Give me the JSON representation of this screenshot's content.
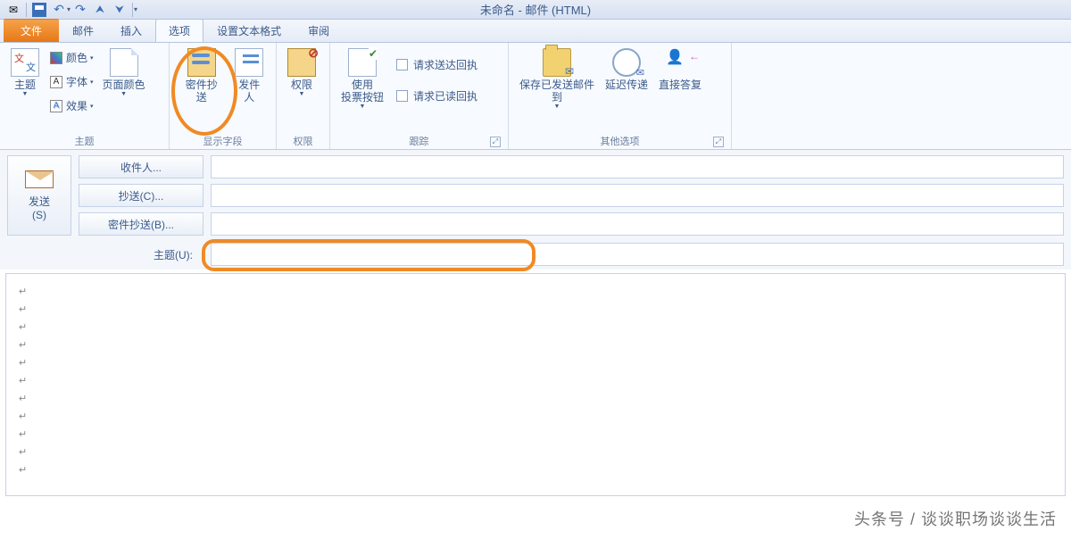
{
  "window": {
    "title": "未命名 - 邮件 (HTML)"
  },
  "tabs": {
    "file": "文件",
    "mail": "邮件",
    "insert": "插入",
    "options": "选项",
    "format": "设置文本格式",
    "review": "审阅"
  },
  "ribbon": {
    "theme": {
      "label": "主题",
      "themes": "主题",
      "color": "颜色",
      "font": "字体",
      "effect": "效果",
      "pageColor": "页面颜色"
    },
    "showFields": {
      "label": "显示字段",
      "bcc": "密件抄送",
      "from": "发件人"
    },
    "permission": {
      "label": "权限",
      "btn": "权限"
    },
    "tracking": {
      "label": "跟踪",
      "voting": "使用\n投票按钮",
      "deliveryReceipt": "请求送达回执",
      "readReceipt": "请求已读回执"
    },
    "moreOptions": {
      "label": "其他选项",
      "saveSent": "保存已发送邮件\n到",
      "delay": "延迟传递",
      "directReply": "直接答复"
    }
  },
  "compose": {
    "send": "发送\n(S)",
    "to": "收件人...",
    "cc": "抄送(C)...",
    "bcc": "密件抄送(B)...",
    "subject": "主题(U):"
  },
  "watermark": "头条号 / 谈谈职场谈谈生活"
}
